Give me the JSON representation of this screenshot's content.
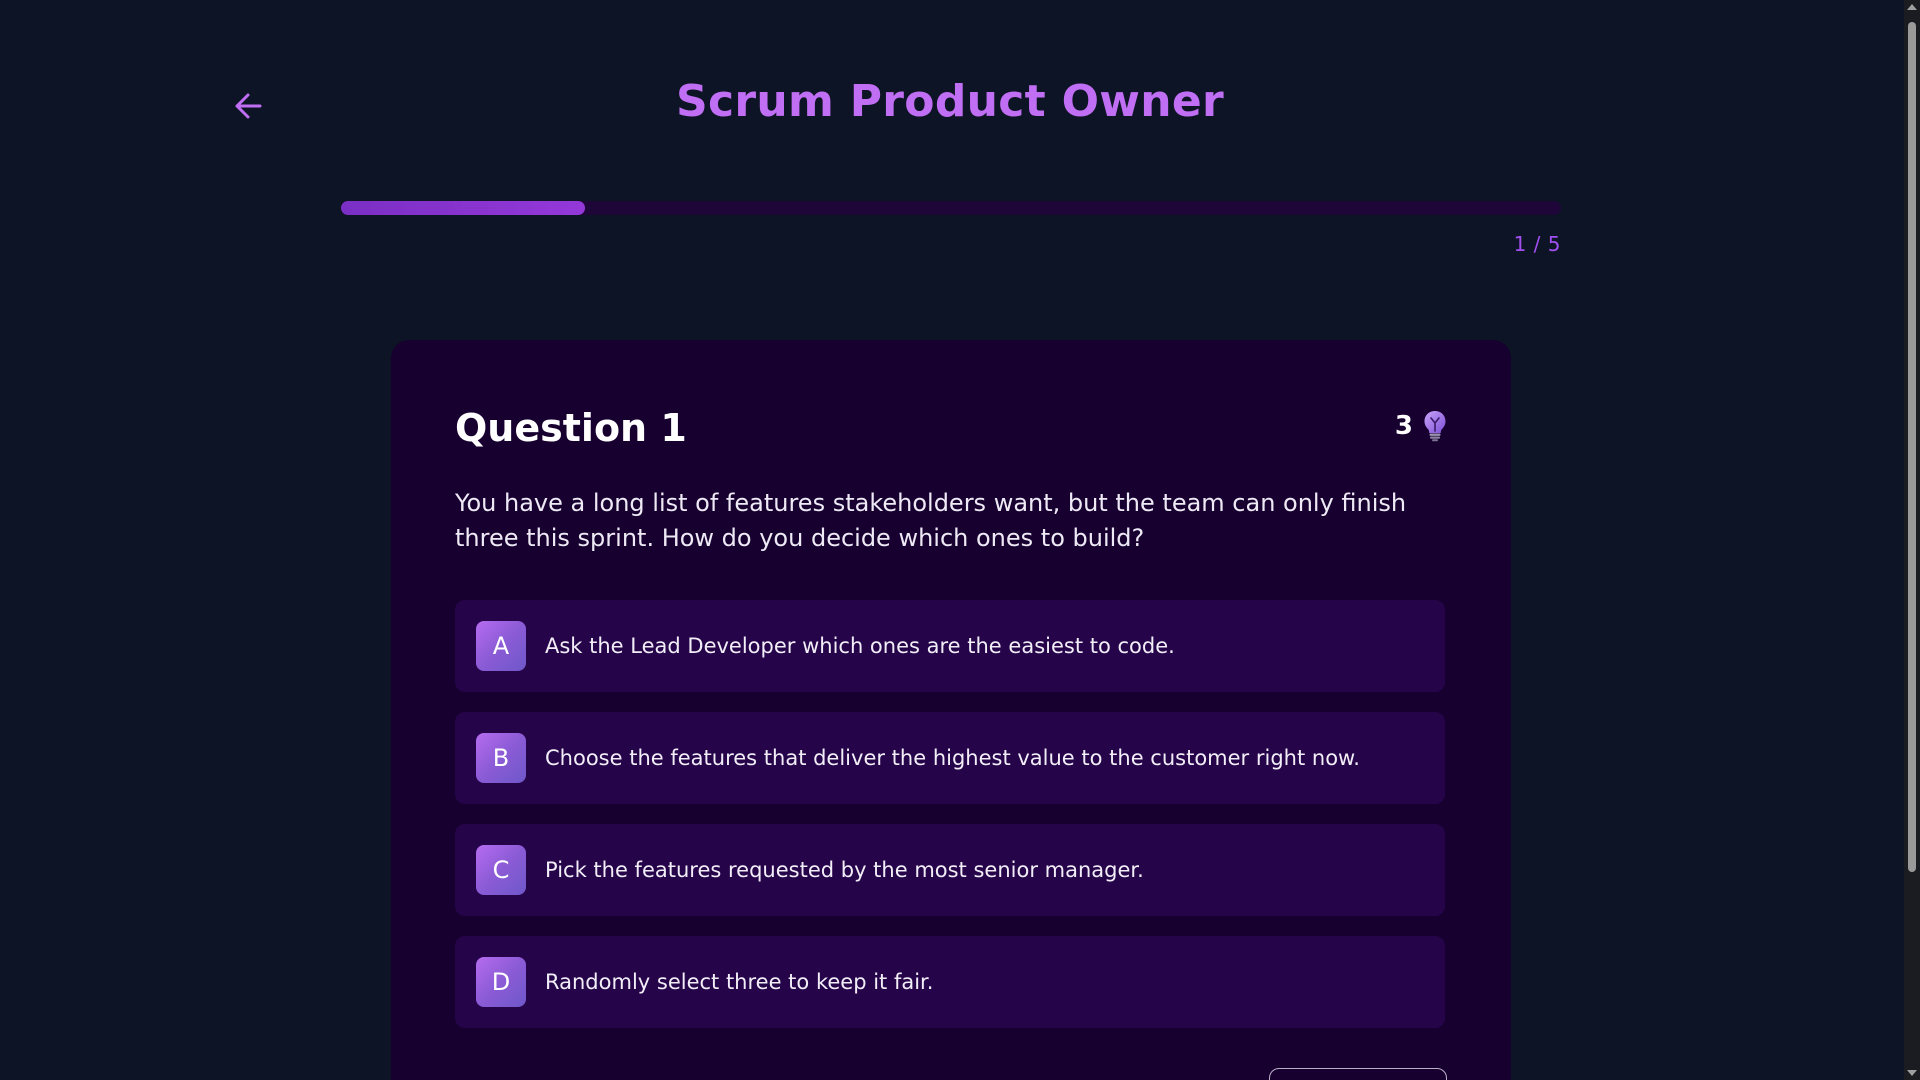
{
  "header": {
    "title": "Scrum Product Owner",
    "back_icon": "arrow-left-icon"
  },
  "progress": {
    "label": "1 / 5",
    "current": 1,
    "total": 5,
    "fraction": 0.2
  },
  "question": {
    "title": "Question 1",
    "hint_count": "3",
    "hint_icon": "lightbulb-icon",
    "text": "You have a long list of features stakeholders want, but the team can only finish three this sprint. How do you decide which ones to build?",
    "options": [
      {
        "letter": "A",
        "text": "Ask the Lead Developer which ones are the easiest to code."
      },
      {
        "letter": "B",
        "text": "Choose the features that deliver the highest value to the customer right now."
      },
      {
        "letter": "C",
        "text": "Pick the features requested by the most senior manager."
      },
      {
        "letter": "D",
        "text": "Randomly select three to keep it fair."
      }
    ]
  },
  "colors": {
    "background": "#0d1425",
    "accent": "#c06ef3",
    "card": "#170030",
    "option": "#26044a",
    "progress_fill": "#8a35d0",
    "progress_track": "#1f0638"
  }
}
